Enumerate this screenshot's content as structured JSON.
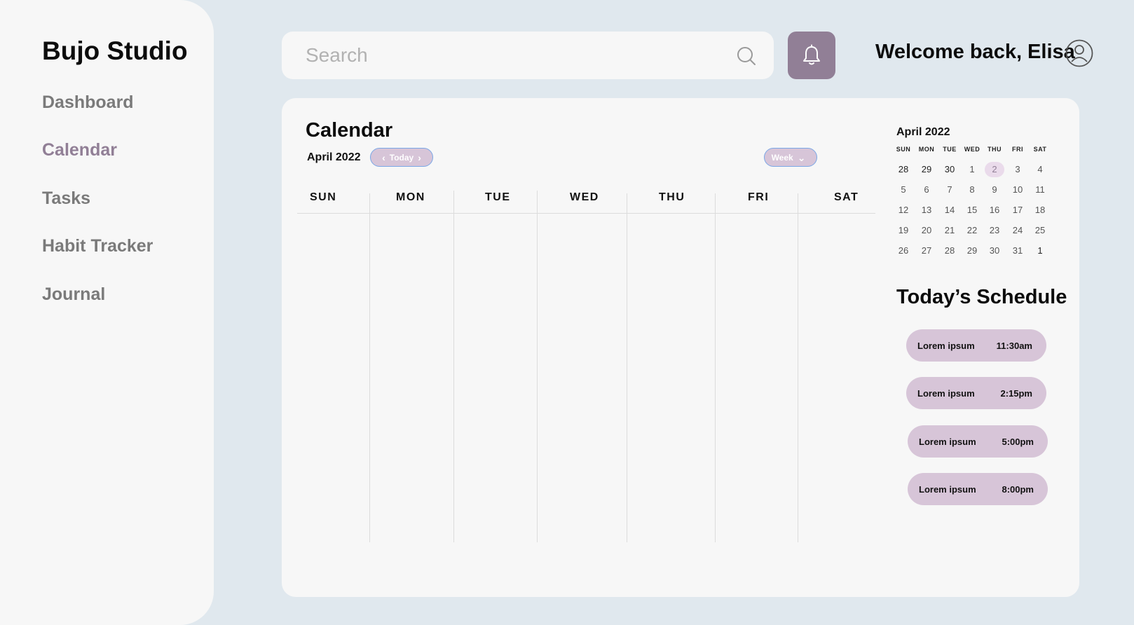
{
  "app": {
    "brand": "Bujo Studio"
  },
  "sidebar": {
    "items": [
      {
        "label": "Dashboard"
      },
      {
        "label": "Calendar"
      },
      {
        "label": "Tasks"
      },
      {
        "label": "Habit Tracker"
      },
      {
        "label": "Journal"
      }
    ],
    "active": "Calendar"
  },
  "header": {
    "search_placeholder": "Search",
    "welcome": "Welcome back, Elisa"
  },
  "calendar": {
    "title": "Calendar",
    "month": "April 2022",
    "today_label": "Today",
    "view_label": "Week",
    "week_days": [
      "SUN",
      "MON",
      "TUE",
      "WED",
      "THU",
      "FRI",
      "SAT"
    ]
  },
  "mini_calendar": {
    "title": "April 2022",
    "dow": [
      "SUN",
      "MON",
      "TUE",
      "WED",
      "THU",
      "FRI",
      "SAT"
    ],
    "weeks": [
      [
        "28",
        "29",
        "30",
        "1",
        "2",
        "3",
        "4"
      ],
      [
        "5",
        "6",
        "7",
        "8",
        "9",
        "10",
        "11"
      ],
      [
        "12",
        "13",
        "14",
        "15",
        "16",
        "17",
        "18"
      ],
      [
        "19",
        "20",
        "21",
        "22",
        "23",
        "24",
        "25"
      ],
      [
        "26",
        "27",
        "28",
        "29",
        "30",
        "31",
        "1"
      ]
    ],
    "highlighted": "2"
  },
  "schedule": {
    "title": "Today’s Schedule",
    "items": [
      {
        "label": "Lorem ipsum",
        "time": "11:30am"
      },
      {
        "label": "Lorem ipsum",
        "time": "2:15pm"
      },
      {
        "label": "Lorem ipsum",
        "time": "5:00pm"
      },
      {
        "label": "Lorem ipsum",
        "time": "8:00pm"
      }
    ]
  },
  "colors": {
    "background": "#e0e8ee",
    "surface": "#f7f7f7",
    "accent": "#917f96",
    "pill": "#d7c5d8",
    "pill_border": "#7aa7e6"
  },
  "icons": [
    "search-icon",
    "bell-icon",
    "user-icon",
    "chevron-left-icon",
    "chevron-right-icon",
    "chevron-down-icon"
  ]
}
